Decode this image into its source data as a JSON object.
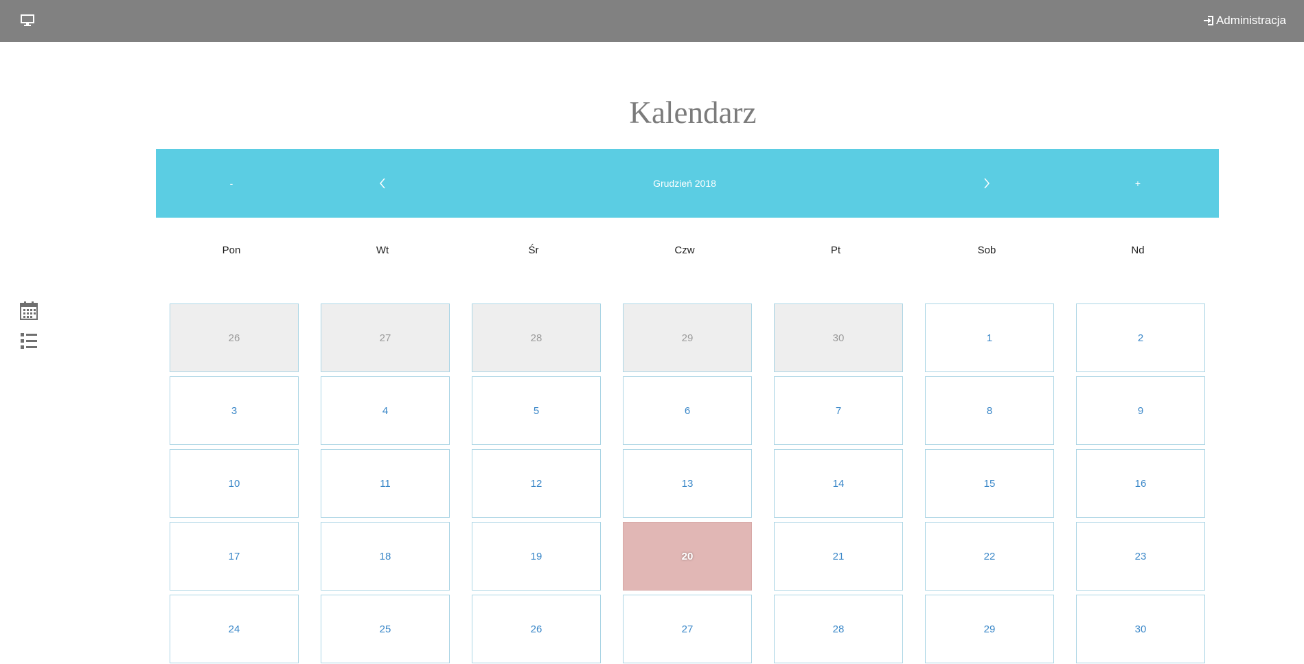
{
  "header": {
    "monitor_icon": "monitor-icon",
    "admin_icon": "login-icon",
    "admin_label": "Administracja"
  },
  "sidebar": {
    "icons": [
      "calendar-icon",
      "list-icon"
    ]
  },
  "page_title": "Kalendarz",
  "nav": {
    "prev_year_label": "-",
    "prev_month_icon": "chevron-left-icon",
    "month_label": "Grudzień 2018",
    "next_month_icon": "chevron-right-icon",
    "next_year_label": "+"
  },
  "weekdays": [
    "Pon",
    "Wt",
    "Śr",
    "Czw",
    "Pt",
    "Sob",
    "Nd"
  ],
  "weeks": [
    [
      {
        "day": "26",
        "state": "other"
      },
      {
        "day": "27",
        "state": "other"
      },
      {
        "day": "28",
        "state": "other"
      },
      {
        "day": "29",
        "state": "other"
      },
      {
        "day": "30",
        "state": "other"
      },
      {
        "day": "1",
        "state": "current"
      },
      {
        "day": "2",
        "state": "current"
      }
    ],
    [
      {
        "day": "3",
        "state": "current"
      },
      {
        "day": "4",
        "state": "current"
      },
      {
        "day": "5",
        "state": "current"
      },
      {
        "day": "6",
        "state": "current"
      },
      {
        "day": "7",
        "state": "current"
      },
      {
        "day": "8",
        "state": "current"
      },
      {
        "day": "9",
        "state": "current"
      }
    ],
    [
      {
        "day": "10",
        "state": "current"
      },
      {
        "day": "11",
        "state": "current"
      },
      {
        "day": "12",
        "state": "current"
      },
      {
        "day": "13",
        "state": "current"
      },
      {
        "day": "14",
        "state": "current"
      },
      {
        "day": "15",
        "state": "current"
      },
      {
        "day": "16",
        "state": "current"
      }
    ],
    [
      {
        "day": "17",
        "state": "current"
      },
      {
        "day": "18",
        "state": "current"
      },
      {
        "day": "19",
        "state": "current"
      },
      {
        "day": "20",
        "state": "today"
      },
      {
        "day": "21",
        "state": "current"
      },
      {
        "day": "22",
        "state": "current"
      },
      {
        "day": "23",
        "state": "current"
      }
    ],
    [
      {
        "day": "24",
        "state": "current"
      },
      {
        "day": "25",
        "state": "current"
      },
      {
        "day": "26",
        "state": "current"
      },
      {
        "day": "27",
        "state": "current"
      },
      {
        "day": "28",
        "state": "current"
      },
      {
        "day": "29",
        "state": "current"
      },
      {
        "day": "30",
        "state": "current"
      }
    ]
  ],
  "colors": {
    "topbar": "#818181",
    "nav_bar": "#5bcde3",
    "day_number": "#3a87c8",
    "other_month_bg": "#eeeeee",
    "today_bg": "#e1b7b5",
    "cell_border": "#a9d4e4"
  }
}
